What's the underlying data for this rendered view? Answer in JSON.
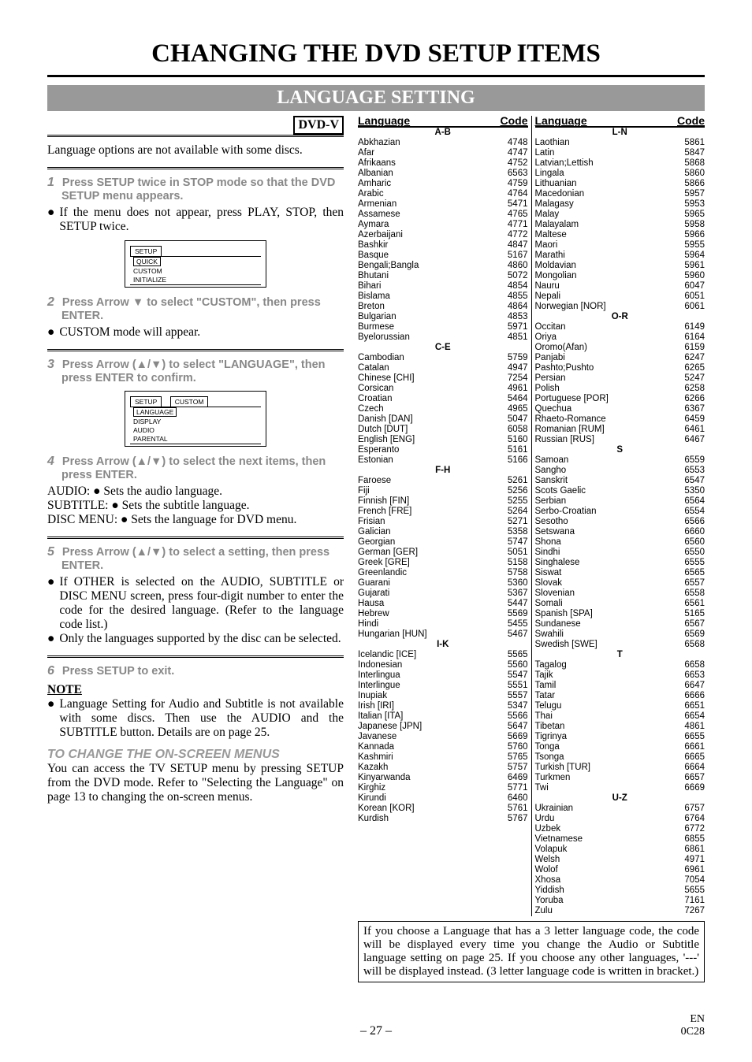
{
  "title": "CHANGING THE DVD SETUP ITEMS",
  "section": "LANGUAGE SETTING",
  "badge": "DVD-V",
  "intro": "Language options are not available with some discs.",
  "step1": "Press SETUP twice in STOP mode so that the DVD SETUP menu appears.",
  "step1n": "1",
  "step1note": "If the menu does not appear, press PLAY, STOP, then SETUP twice.",
  "diag1_title": "SETUP",
  "diag1_r1": "QUICK",
  "diag1_r2": "CUSTOM",
  "diag1_r3": "INITIALIZE",
  "step2n": "2",
  "step2": "Press Arrow ▼ to select \"CUSTOM\", then press ENTER.",
  "step2note": "CUSTOM mode will appear.",
  "step3n": "3",
  "step3": "Press Arrow (▲/▼) to select \"LANGUAGE\", then press ENTER to confirm.",
  "diag2_title": "SETUP",
  "diag2_tab": "CUSTOM",
  "diag2_r1": "LANGUAGE",
  "diag2_r2": "DISPLAY",
  "diag2_r3": "AUDIO",
  "diag2_r4": "PARENTAL",
  "step4n": "4",
  "step4": "Press Arrow (▲/▼) to select the next items, then press ENTER.",
  "def_audio_l": "AUDIO: ",
  "def_audio_t": "Sets the audio language.",
  "def_sub_l": "SUBTITLE: ",
  "def_sub_t": "Sets the subtitle language.",
  "def_disc_l": "DISC MENU: ",
  "def_disc_t": "Sets the language for DVD menu.",
  "step5n": "5",
  "step5": "Press Arrow (▲/▼) to select a setting, then press ENTER.",
  "other1": "If OTHER is selected on the AUDIO, SUBTITLE or DISC MENU screen, press four-digit number to enter the code for the desired language. (Refer to the language code list.)",
  "other2": "Only the languages supported by the disc can be selected.",
  "step6n": "6",
  "step6": "Press SETUP to exit.",
  "note_h": "NOTE",
  "note_b": "Language Setting for Audio and Subtitle is not available with some discs. Then use the AUDIO and the SUBTITLE button. Details are on page 25.",
  "change_h": "TO CHANGE THE ON-SCREEN MENUS",
  "change_b": "You can access the TV SETUP menu by pressing SETUP from the DVD mode. Refer to \"Selecting the Language\" on page 13 to changing the on-screen menus.",
  "th_lang": "Language",
  "th_code": "Code",
  "col1_groups": [
    {
      "g": "A-B",
      "rows": [
        [
          "Abkhazian",
          "4748"
        ],
        [
          "Afar",
          "4747"
        ],
        [
          "Afrikaans",
          "4752"
        ],
        [
          "Albanian",
          "6563"
        ],
        [
          "Amharic",
          "4759"
        ],
        [
          "Arabic",
          "4764"
        ],
        [
          "Armenian",
          "5471"
        ],
        [
          "Assamese",
          "4765"
        ],
        [
          "Aymara",
          "4771"
        ],
        [
          "Azerbaijani",
          "4772"
        ],
        [
          "Bashkir",
          "4847"
        ],
        [
          "Basque",
          "5167"
        ],
        [
          "Bengali;Bangla",
          "4860"
        ],
        [
          "Bhutani",
          "5072"
        ],
        [
          "Bihari",
          "4854"
        ],
        [
          "Bislama",
          "4855"
        ],
        [
          "Breton",
          "4864"
        ],
        [
          "Bulgarian",
          "4853"
        ],
        [
          "Burmese",
          "5971"
        ],
        [
          "Byelorussian",
          "4851"
        ]
      ]
    },
    {
      "g": "C-E",
      "rows": [
        [
          "Cambodian",
          "5759"
        ],
        [
          "Catalan",
          "4947"
        ],
        [
          "Chinese [CHI]",
          "7254"
        ],
        [
          "Corsican",
          "4961"
        ],
        [
          "Croatian",
          "5464"
        ],
        [
          "Czech",
          "4965"
        ],
        [
          "Danish [DAN]",
          "5047"
        ],
        [
          "Dutch [DUT]",
          "6058"
        ],
        [
          "English [ENG]",
          "5160"
        ],
        [
          "Esperanto",
          "5161"
        ],
        [
          "Estonian",
          "5166"
        ]
      ]
    },
    {
      "g": "F-H",
      "rows": [
        [
          "Faroese",
          "5261"
        ],
        [
          "Fiji",
          "5256"
        ],
        [
          "Finnish [FIN]",
          "5255"
        ],
        [
          "French [FRE]",
          "5264"
        ],
        [
          "Frisian",
          "5271"
        ],
        [
          "Galician",
          "5358"
        ],
        [
          "Georgian",
          "5747"
        ],
        [
          "German [GER]",
          "5051"
        ],
        [
          "Greek [GRE]",
          "5158"
        ],
        [
          "Greenlandic",
          "5758"
        ],
        [
          "Guarani",
          "5360"
        ],
        [
          "Gujarati",
          "5367"
        ],
        [
          "Hausa",
          "5447"
        ],
        [
          "Hebrew",
          "5569"
        ],
        [
          "Hindi",
          "5455"
        ],
        [
          "Hungarian [HUN]",
          "5467"
        ]
      ]
    },
    {
      "g": "I-K",
      "rows": [
        [
          "Icelandic [ICE]",
          "5565"
        ],
        [
          "Indonesian",
          "5560"
        ],
        [
          "Interlingua",
          "5547"
        ],
        [
          "Interlingue",
          "5551"
        ],
        [
          "Inupiak",
          "5557"
        ],
        [
          "Irish [IRI]",
          "5347"
        ],
        [
          "Italian [ITA]",
          "5566"
        ],
        [
          "Japanese [JPN]",
          "5647"
        ],
        [
          "Javanese",
          "5669"
        ],
        [
          "Kannada",
          "5760"
        ],
        [
          "Kashmiri",
          "5765"
        ],
        [
          "Kazakh",
          "5757"
        ],
        [
          "Kinyarwanda",
          "6469"
        ],
        [
          "Kirghiz",
          "5771"
        ],
        [
          "Kirundi",
          "6460"
        ],
        [
          "Korean [KOR]",
          "5761"
        ],
        [
          "Kurdish",
          "5767"
        ]
      ]
    }
  ],
  "col2_groups": [
    {
      "g": "L-N",
      "rows": [
        [
          "Laothian",
          "5861"
        ],
        [
          "Latin",
          "5847"
        ],
        [
          "Latvian;Lettish",
          "5868"
        ],
        [
          "Lingala",
          "5860"
        ],
        [
          "Lithuanian",
          "5866"
        ],
        [
          "Macedonian",
          "5957"
        ],
        [
          "Malagasy",
          "5953"
        ],
        [
          "Malay",
          "5965"
        ],
        [
          "Malayalam",
          "5958"
        ],
        [
          "Maltese",
          "5966"
        ],
        [
          "Maori",
          "5955"
        ],
        [
          "Marathi",
          "5964"
        ],
        [
          "Moldavian",
          "5961"
        ],
        [
          "Mongolian",
          "5960"
        ],
        [
          "Nauru",
          "6047"
        ],
        [
          "Nepali",
          "6051"
        ],
        [
          "Norwegian [NOR]",
          "6061"
        ]
      ]
    },
    {
      "g": "O-R",
      "rows": [
        [
          "Occitan",
          "6149"
        ],
        [
          "Oriya",
          "6164"
        ],
        [
          "Oromo(Afan)",
          "6159"
        ],
        [
          "Panjabi",
          "6247"
        ],
        [
          "Pashto;Pushto",
          "6265"
        ],
        [
          "Persian",
          "5247"
        ],
        [
          "Polish",
          "6258"
        ],
        [
          "Portuguese [POR]",
          "6266"
        ],
        [
          "Quechua",
          "6367"
        ],
        [
          "Rhaeto-Romance",
          "6459"
        ],
        [
          "Romanian [RUM]",
          "6461"
        ],
        [
          "Russian [RUS]",
          "6467"
        ]
      ]
    },
    {
      "g": "S",
      "rows": [
        [
          "Samoan",
          "6559"
        ],
        [
          "Sangho",
          "6553"
        ],
        [
          "Sanskrit",
          "6547"
        ],
        [
          "Scots Gaelic",
          "5350"
        ],
        [
          "Serbian",
          "6564"
        ],
        [
          "Serbo-Croatian",
          "6554"
        ],
        [
          "Sesotho",
          "6566"
        ],
        [
          "Setswana",
          "6660"
        ],
        [
          "Shona",
          "6560"
        ],
        [
          "Sindhi",
          "6550"
        ],
        [
          "Singhalese",
          "6555"
        ],
        [
          "Siswat",
          "6565"
        ],
        [
          "Slovak",
          "6557"
        ],
        [
          "Slovenian",
          "6558"
        ],
        [
          "Somali",
          "6561"
        ],
        [
          "Spanish [SPA]",
          "5165"
        ],
        [
          "Sundanese",
          "6567"
        ],
        [
          "Swahili",
          "6569"
        ],
        [
          "Swedish [SWE]",
          "6568"
        ]
      ]
    },
    {
      "g": "T",
      "rows": [
        [
          "Tagalog",
          "6658"
        ],
        [
          "Tajik",
          "6653"
        ],
        [
          "Tamil",
          "6647"
        ],
        [
          "Tatar",
          "6666"
        ],
        [
          "Telugu",
          "6651"
        ],
        [
          "Thai",
          "6654"
        ],
        [
          "Tibetan",
          "4861"
        ],
        [
          "Tigrinya",
          "6655"
        ],
        [
          "Tonga",
          "6661"
        ],
        [
          "Tsonga",
          "6665"
        ],
        [
          "Turkish [TUR]",
          "6664"
        ],
        [
          "Turkmen",
          "6657"
        ],
        [
          "Twi",
          "6669"
        ]
      ]
    },
    {
      "g": "U-Z",
      "rows": [
        [
          "Ukrainian",
          "6757"
        ],
        [
          "Urdu",
          "6764"
        ],
        [
          "Uzbek",
          "6772"
        ],
        [
          "Vietnamese",
          "6855"
        ],
        [
          "Volapuk",
          "6861"
        ],
        [
          "Welsh",
          "4971"
        ],
        [
          "Wolof",
          "6961"
        ],
        [
          "Xhosa",
          "7054"
        ],
        [
          "Yiddish",
          "5655"
        ],
        [
          "Yoruba",
          "7161"
        ],
        [
          "Zulu",
          "7267"
        ]
      ]
    }
  ],
  "footbox": "If you choose a Language that has a 3 letter language code, the code will be displayed every time you change the Audio or Subtitle language setting on page 25. If you choose any other languages, '---' will be displayed instead. (3 letter language code is written in bracket.)",
  "page_num": "– 27 –",
  "foot_en": "EN",
  "foot_code": "0C28"
}
